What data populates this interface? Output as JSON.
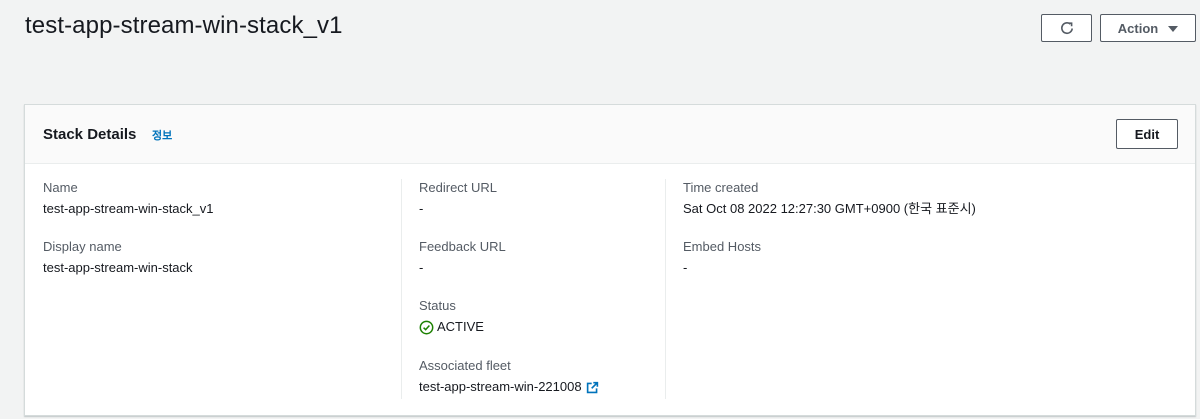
{
  "header": {
    "title": "test-app-stream-win-stack_v1",
    "action_label": "Action"
  },
  "panel": {
    "title": "Stack Details",
    "info_label": "정보",
    "edit_label": "Edit",
    "fields": {
      "name": {
        "label": "Name",
        "value": "test-app-stream-win-stack_v1"
      },
      "display_name": {
        "label": "Display name",
        "value": "test-app-stream-win-stack"
      },
      "redirect_url": {
        "label": "Redirect URL",
        "value": "-"
      },
      "feedback_url": {
        "label": "Feedback URL",
        "value": "-"
      },
      "status": {
        "label": "Status",
        "value": "ACTIVE"
      },
      "associated_fleet": {
        "label": "Associated fleet",
        "value": "test-app-stream-win-221008"
      },
      "time_created": {
        "label": "Time created",
        "value": "Sat Oct 08 2022 12:27:30 GMT+0900 (한국 표준시)"
      },
      "embed_hosts": {
        "label": "Embed Hosts",
        "value": "-"
      }
    }
  },
  "icons": {
    "refresh": "refresh-icon",
    "caret": "caret-down-icon",
    "status": "check-circle-icon",
    "external": "external-link-icon"
  },
  "colors": {
    "accent": "#0073bb",
    "success": "#1d8102",
    "text": "#16191f",
    "muted": "#545b64"
  }
}
